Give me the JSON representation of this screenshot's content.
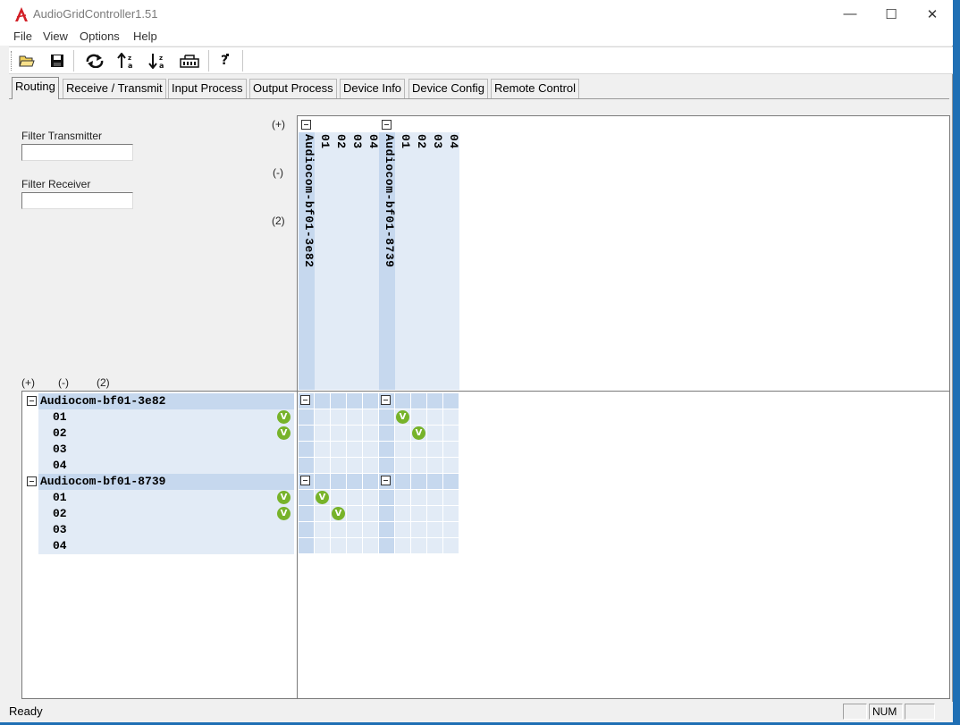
{
  "window": {
    "title": "AudioGridController1.51",
    "minimize_glyph": "—",
    "maximize_glyph": "☐",
    "close_glyph": "✕"
  },
  "menu": [
    "File",
    "View",
    "Options",
    "Help"
  ],
  "toolbar": {
    "icons": [
      "open-folder-icon",
      "save-icon",
      "refresh-icon",
      "sort-ascending-icon",
      "sort-descending-icon",
      "network-icon",
      "help-icon"
    ]
  },
  "tabs": [
    "Routing",
    "Receive / Transmit",
    "Input Process",
    "Output Process",
    "Device Info",
    "Device Config",
    "Remote Control"
  ],
  "active_tab": "Routing",
  "filters": {
    "transmitter_label": "Filter Transmitter",
    "transmitter_value": "",
    "receiver_label": "Filter Receiver",
    "receiver_value": ""
  },
  "top_controls": {
    "expand": "(+)",
    "collapse": "(-)",
    "count": "(2)"
  },
  "left_controls": {
    "expand": "(+)",
    "collapse": "(-)",
    "count": "(2)"
  },
  "transmitters": [
    {
      "name": "Audiocom-bf01-3e82",
      "channels": [
        "01",
        "02",
        "03",
        "04"
      ]
    },
    {
      "name": "Audiocom-bf01-8739",
      "channels": [
        "01",
        "02",
        "03",
        "04"
      ]
    }
  ],
  "receivers": [
    {
      "name": "Audiocom-bf01-3e82",
      "channels": [
        "01",
        "02",
        "03",
        "04"
      ],
      "status": [
        true,
        true,
        false,
        false
      ]
    },
    {
      "name": "Audiocom-bf01-8739",
      "channels": [
        "01",
        "02",
        "03",
        "04"
      ],
      "status": [
        true,
        true,
        false,
        false
      ]
    }
  ],
  "routes": [
    {
      "rx_device": 0,
      "rx_channel": 0,
      "tx_device": 1,
      "tx_channel": 0
    },
    {
      "rx_device": 0,
      "rx_channel": 1,
      "tx_device": 1,
      "tx_channel": 1
    },
    {
      "rx_device": 1,
      "rx_channel": 0,
      "tx_device": 0,
      "tx_channel": 0
    },
    {
      "rx_device": 1,
      "rx_channel": 1,
      "tx_device": 0,
      "tx_channel": 1
    }
  ],
  "route_mark": "V",
  "status": {
    "text": "Ready",
    "num": "NUM"
  }
}
